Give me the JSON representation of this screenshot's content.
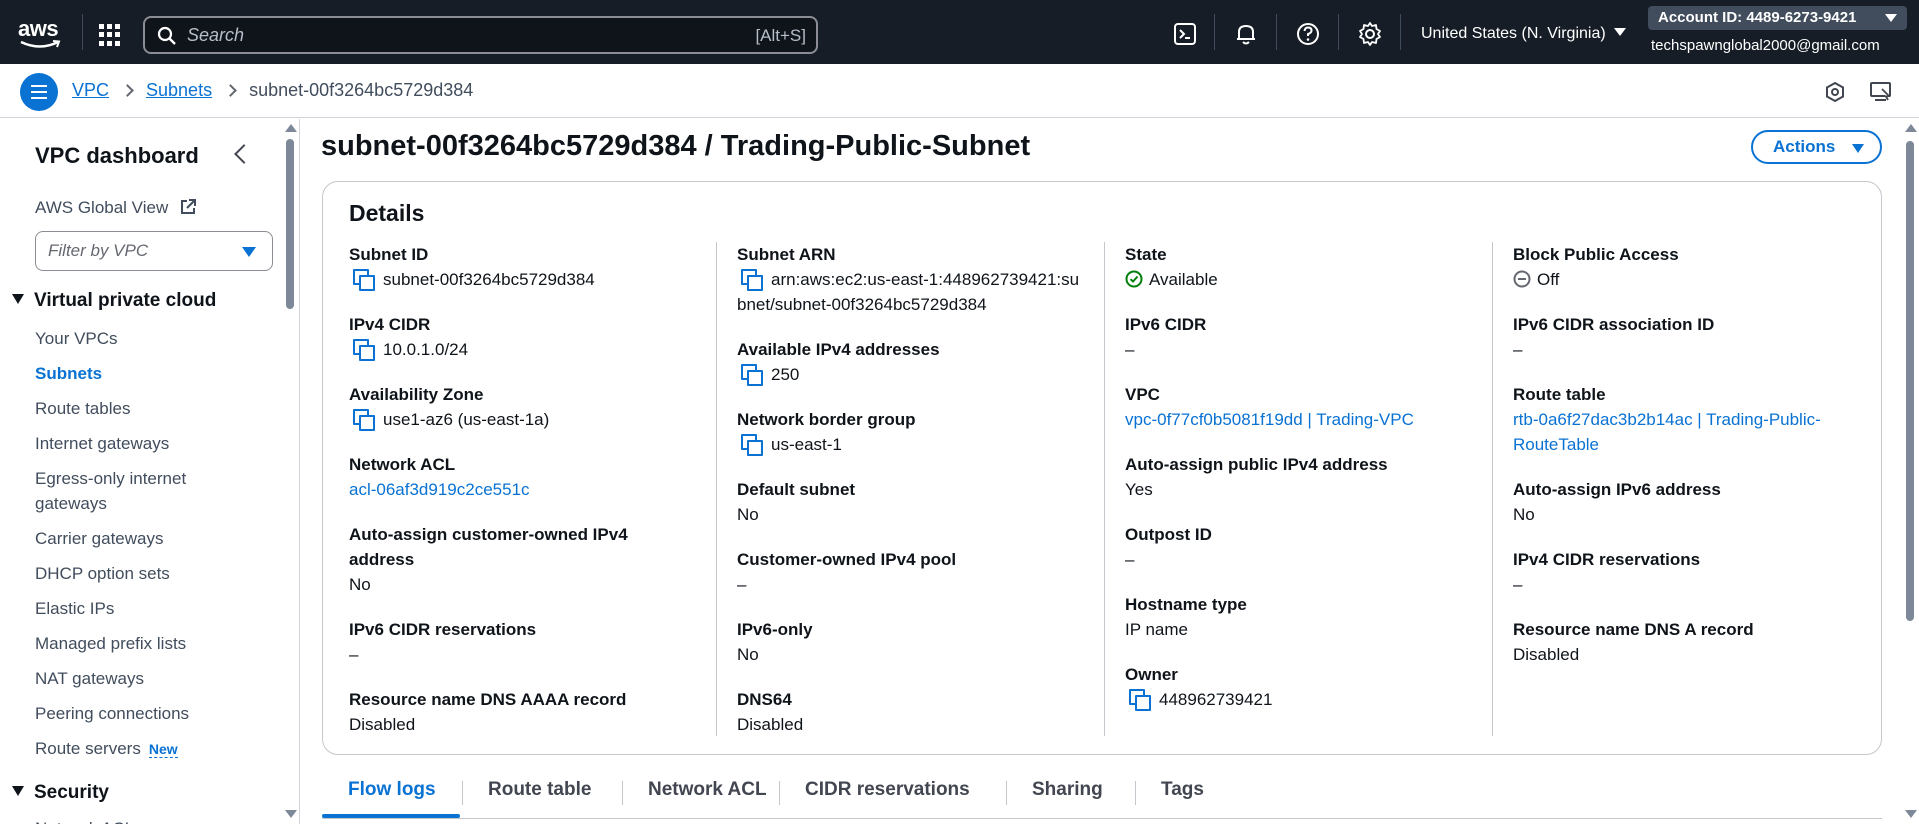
{
  "topnav": {
    "logo_text": "aws",
    "search_placeholder": "Search",
    "search_shortcut": "[Alt+S]",
    "icons": [
      "cloudshell-icon",
      "bell-icon",
      "help-icon",
      "gear-icon"
    ],
    "region": "United States (N. Virginia)",
    "account_id": "Account ID: 4489-6273-9421",
    "account_email": "techspawnglobal2000@gmail.com"
  },
  "breadcrumb": {
    "items": [
      "VPC",
      "Subnets"
    ],
    "current": "subnet-00f3264bc5729d384"
  },
  "sidebar": {
    "title": "VPC dashboard",
    "global_view": "AWS Global View",
    "filter_placeholder": "Filter by VPC",
    "section1": "Virtual private cloud",
    "items": [
      {
        "label": "Your VPCs"
      },
      {
        "label": "Subnets"
      },
      {
        "label": "Route tables"
      },
      {
        "label": "Internet gateways"
      },
      {
        "label": "Egress-only internet gateways"
      },
      {
        "label": "Carrier gateways"
      },
      {
        "label": "DHCP option sets"
      },
      {
        "label": "Elastic IPs"
      },
      {
        "label": "Managed prefix lists"
      },
      {
        "label": "NAT gateways"
      },
      {
        "label": "Peering connections"
      },
      {
        "label": "Route servers"
      }
    ],
    "new_badge": "New",
    "section2": "Security",
    "partial_item": "Network ACLs"
  },
  "main": {
    "title": "subnet-00f3264bc5729d384 / Trading-Public-Subnet",
    "actions_label": "Actions",
    "details_title": "Details",
    "col1": {
      "subnet_id_label": "Subnet ID",
      "subnet_id": "subnet-00f3264bc5729d384",
      "ipv4_cidr_label": "IPv4 CIDR",
      "ipv4_cidr": "10.0.1.0/24",
      "az_label": "Availability Zone",
      "az": "use1-az6 (us-east-1a)",
      "nacl_label": "Network ACL",
      "nacl": "acl-06af3d919c2ce551c",
      "auto_cust_label": "Auto-assign customer-owned IPv4 address",
      "auto_cust": "No",
      "ipv6_res_label": "IPv6 CIDR reservations",
      "ipv6_res": "–",
      "dns_aaaa_label": "Resource name DNS AAAA record",
      "dns_aaaa": "Disabled"
    },
    "col2": {
      "arn_label": "Subnet ARN",
      "arn": "arn:aws:ec2:us-east-1:448962739421:subnet/subnet-00f3264bc5729d384",
      "avail_ipv4_label": "Available IPv4 addresses",
      "avail_ipv4": "250",
      "nbg_label": "Network border group",
      "nbg": "us-east-1",
      "default_label": "Default subnet",
      "default": "No",
      "coip_label": "Customer-owned IPv4 pool",
      "coip": "–",
      "ipv6only_label": "IPv6-only",
      "ipv6only": "No",
      "dns64_label": "DNS64",
      "dns64": "Disabled"
    },
    "col3": {
      "state_label": "State",
      "state": "Available",
      "ipv6_cidr_label": "IPv6 CIDR",
      "ipv6_cidr": "–",
      "vpc_label": "VPC",
      "vpc": "vpc-0f77cf0b5081f19dd | Trading-VPC",
      "auto_pub_label": "Auto-assign public IPv4 address",
      "auto_pub": "Yes",
      "outpost_label": "Outpost ID",
      "outpost": "–",
      "hostname_label": "Hostname type",
      "hostname": "IP name",
      "owner_label": "Owner",
      "owner": "448962739421"
    },
    "col4": {
      "bpa_label": "Block Public Access",
      "bpa": "Off",
      "ipv6_assoc_label": "IPv6 CIDR association ID",
      "ipv6_assoc": "–",
      "rtb_label": "Route table",
      "rtb": "rtb-0a6f27dac3b2b14ac | Trading-Public-RouteTable",
      "auto_ipv6_label": "Auto-assign IPv6 address",
      "auto_ipv6": "No",
      "ipv4_res_label": "IPv4 CIDR reservations",
      "ipv4_res": "–",
      "dns_a_label": "Resource name DNS A record",
      "dns_a": "Disabled"
    },
    "tabs": [
      "Flow logs",
      "Route table",
      "Network ACL",
      "CIDR reservations",
      "Sharing",
      "Tags"
    ]
  },
  "colors": {
    "nav_bg": "#161d26",
    "link": "#0972d3",
    "success": "#037f0c"
  }
}
